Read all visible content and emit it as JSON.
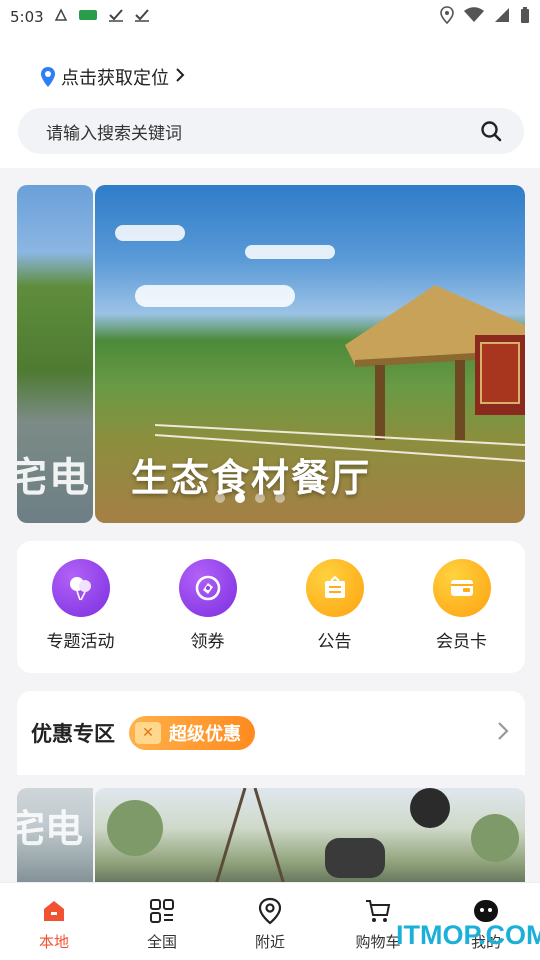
{
  "status_bar": {
    "time": "5:03",
    "left_icons": [
      "notification-icon",
      "app-icon",
      "check-icon",
      "check-icon"
    ],
    "right_icons": [
      "location-icon",
      "wifi-icon",
      "signal-icon",
      "battery-icon"
    ]
  },
  "header": {
    "location_label": "点击获取定位",
    "search_placeholder": "请输入搜索关键词"
  },
  "banner": {
    "prev_caption": "宅电",
    "main_caption": "生态食材餐厅",
    "dot_count": 4,
    "active_dot": 1
  },
  "quick_actions": [
    {
      "label": "专题活动",
      "icon": "balloon-icon",
      "color": "#8a3ceb"
    },
    {
      "label": "领券",
      "icon": "coupon-icon",
      "color": "#8a3ceb"
    },
    {
      "label": "公告",
      "icon": "notice-icon",
      "color": "#ffae1a"
    },
    {
      "label": "会员卡",
      "icon": "card-icon",
      "color": "#ffae1a"
    }
  ],
  "deals": {
    "title": "优惠专区",
    "badge": "超级优惠"
  },
  "photos": {
    "prev_caption": "宅电"
  },
  "tabs": [
    {
      "label": "本地",
      "icon": "home-icon",
      "active": true
    },
    {
      "label": "全国",
      "icon": "grid-icon",
      "active": false
    },
    {
      "label": "附近",
      "icon": "pin-icon",
      "active": false
    },
    {
      "label": "购物车",
      "icon": "cart-icon",
      "active": false
    },
    {
      "label": "我的",
      "icon": "face-icon",
      "active": false
    }
  ],
  "watermark": "ITMOP.COM",
  "colors": {
    "accent": "#f05232",
    "purple": "#8a3ceb",
    "orange": "#ffae1a",
    "search_bg": "#f2f3f6"
  }
}
